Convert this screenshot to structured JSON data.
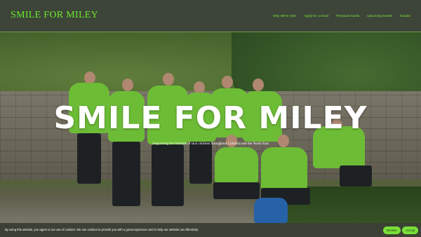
{
  "header": {
    "logo": "SMILE FOR MILEY",
    "nav": [
      "Why We're Here",
      "Apply for a Grant",
      "Previous Grants",
      "Upcoming Events",
      "Donate"
    ]
  },
  "hero": {
    "title": "SMILE FOR MILEY",
    "subtitle": "Supporting the families of sick children throughout Cumbria and the North East"
  },
  "cookie": {
    "text": "By using this website, you agree to our use of cookies. We use cookies to provide you with a great experience and to help our website run effectively.",
    "decline": "Decline",
    "accept": "Accept"
  },
  "colors": {
    "accent": "#79e039",
    "header_bg": "#3d4538",
    "cookie_bg": "#3b4235"
  }
}
